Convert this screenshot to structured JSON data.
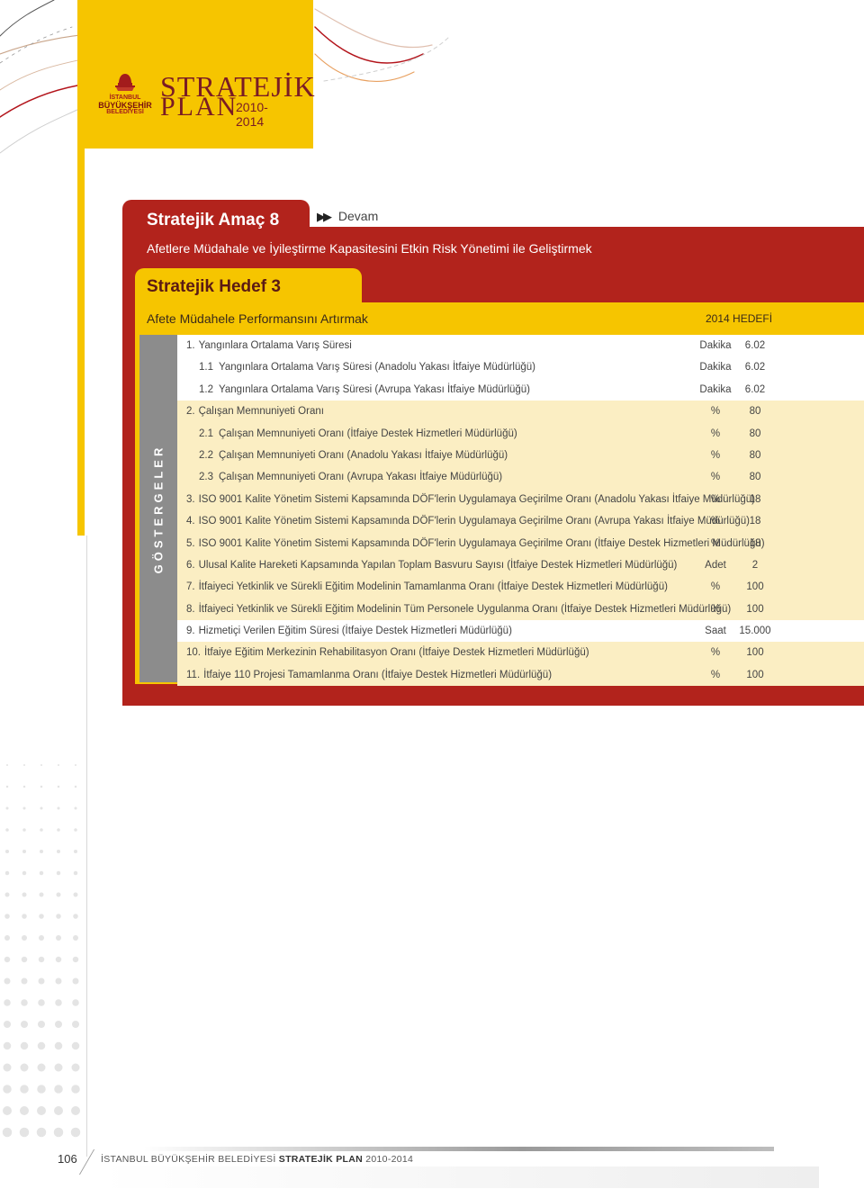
{
  "header": {
    "logo_ibb_lines": [
      "İSTANBUL",
      "BÜYÜKŞEHİR",
      "BELEDİYESİ"
    ],
    "logo_strategic": "STRATEJİK",
    "logo_plan": "PLAN",
    "logo_years": "2010-2014"
  },
  "section": {
    "title": "Stratejik Amaç 8",
    "continued": "Devam",
    "subtitle": "Afetlere Müdahale ve İyileştirme Kapasitesini Etkin Risk Yönetimi ile Geliştirmek"
  },
  "goal": {
    "title": "Stratejik Hedef 3",
    "subtitle": "Afete Müdahele Performansını Artırmak",
    "target_header": "2014 HEDEFİ",
    "side_label": "GÖSTERGELER"
  },
  "indicators": [
    {
      "num": "1.",
      "label": "Yangınlara Ortalama Varış Süresi",
      "unit": "Dakika",
      "value": "6.02",
      "level": "main",
      "bg": "w"
    },
    {
      "num": "1.1",
      "label": "Yangınlara Ortalama Varış Süresi (Anadolu Yakası İtfaiye Müdürlüğü)",
      "unit": "Dakika",
      "value": "6.02",
      "level": "sub",
      "bg": "w"
    },
    {
      "num": "1.2",
      "label": "Yangınlara Ortalama Varış Süresi (Avrupa Yakası İtfaiye Müdürlüğü)",
      "unit": "Dakika",
      "value": "6.02",
      "level": "sub",
      "bg": "w"
    },
    {
      "num": "2.",
      "label": "Çalışan Memnuniyeti  Oranı",
      "unit": "%",
      "value": "80",
      "level": "main",
      "bg": "c"
    },
    {
      "num": "2.1",
      "label": "Çalışan Memnuniyeti Oranı (İtfaiye Destek Hizmetleri Müdürlüğü)",
      "unit": "%",
      "value": "80",
      "level": "sub",
      "bg": "c"
    },
    {
      "num": "2.2",
      "label": "Çalışan Memnuniyeti Oranı (Anadolu Yakası İtfaiye Müdürlüğü)",
      "unit": "%",
      "value": "80",
      "level": "sub",
      "bg": "c"
    },
    {
      "num": "2.3",
      "label": "Çalışan Memnuniyeti Oranı (Avrupa Yakası İtfaiye Müdürlüğü)",
      "unit": "%",
      "value": "80",
      "level": "sub",
      "bg": "c"
    },
    {
      "num": "3.",
      "label": "ISO 9001 Kalite Yönetim Sistemi Kapsamında DÖF'lerin Uygulamaya Geçirilme Oranı (Anadolu Yakası İtfaiye Müdürlüğü)",
      "unit": "%",
      "value": "18",
      "level": "main",
      "bg": "c"
    },
    {
      "num": "4.",
      "label": "ISO 9001 Kalite Yönetim Sistemi Kapsamında DÖF'lerin Uygulamaya Geçirilme Oranı (Avrupa Yakası İtfaiye Müdürlüğü)",
      "unit": "%",
      "value": "18",
      "level": "main",
      "bg": "c"
    },
    {
      "num": "5.",
      "label": "ISO 9001 Kalite Yönetim Sistemi Kapsamında DÖF'lerin Uygulamaya Geçirilme Oranı (İtfaiye Destek Hizmetleri Müdürlüğü)",
      "unit": "%",
      "value": "18",
      "level": "main",
      "bg": "c"
    },
    {
      "num": "6.",
      "label": "Ulusal Kalite Hareketi Kapsamında Yapılan Toplam Basvuru Sayısı (İtfaiye Destek Hizmetleri Müdürlüğü)",
      "unit": "Adet",
      "value": "2",
      "level": "main",
      "bg": "c"
    },
    {
      "num": "7.",
      "label": "İtfaiyeci Yetkinlik ve Sürekli Eğitim Modelinin Tamamlanma Oranı (İtfaiye Destek Hizmetleri Müdürlüğü)",
      "unit": "%",
      "value": "100",
      "level": "main",
      "bg": "c"
    },
    {
      "num": "8.",
      "label": "İtfaiyeci Yetkinlik ve Sürekli Eğitim Modelinin Tüm Personele Uygulanma Oranı (İtfaiye Destek Hizmetleri Müdürlüğü)",
      "unit": "%",
      "value": "100",
      "level": "main",
      "bg": "c"
    },
    {
      "num": "9.",
      "label": "Hizmetiçi Verilen Eğitim Süresi (İtfaiye Destek Hizmetleri Müdürlüğü)",
      "unit": "Saat",
      "value": "15.000",
      "level": "main",
      "bg": "w"
    },
    {
      "num": "10.",
      "label": "İtfaiye Eğitim Merkezinin Rehabilitasyon Oranı (İtfaiye Destek Hizmetleri Müdürlüğü)",
      "unit": "%",
      "value": "100",
      "level": "main",
      "bg": "c"
    },
    {
      "num": "11.",
      "label": "İtfaiye 110 Projesi Tamamlanma Oranı (İtfaiye Destek Hizmetleri Müdürlüğü)",
      "unit": "%",
      "value": "100",
      "level": "main",
      "bg": "c"
    }
  ],
  "footer": {
    "page_number": "106",
    "org": "İSTANBUL BÜYÜKŞEHİR BELEDİYESİ",
    "plan": "STRATEJİK PLAN",
    "years": "2010-2014"
  }
}
